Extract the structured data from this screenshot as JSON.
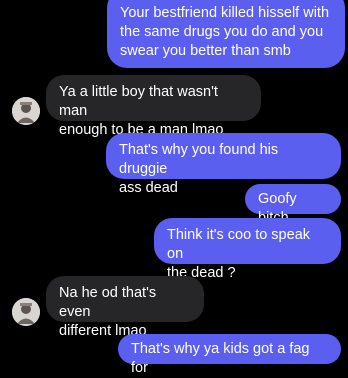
{
  "thread": {
    "messages": [
      {
        "from": "me",
        "text": "Your bestfriend killed hisself with\nthe same drugs you do and you\nswear you better than smb"
      },
      {
        "from": "them",
        "text": "Ya a little boy that wasn't man\nenough to be a man lmao"
      },
      {
        "from": "me",
        "text": "That's why you found his druggie\nass dead"
      },
      {
        "from": "me",
        "text": "Goofy bitch"
      },
      {
        "from": "me",
        "text": "Think it's coo to speak on\nthe dead ?"
      },
      {
        "from": "them",
        "text": "Na he od that's even\ndifferent lmao"
      },
      {
        "from": "me",
        "text": "That's why ya kids got a fag for"
      }
    ]
  },
  "colors": {
    "background": "#000000",
    "sent_bubble": "#5a5ff0",
    "received_bubble": "#262628",
    "text": "#ffffff"
  },
  "icons": {
    "contact_avatar": "contact-avatar-icon"
  }
}
